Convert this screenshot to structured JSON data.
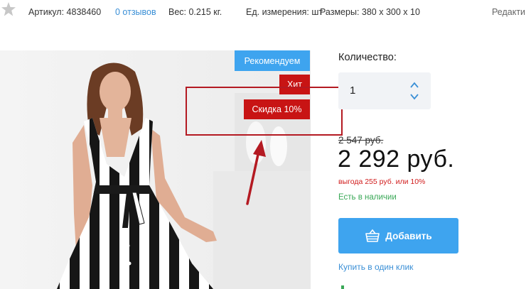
{
  "meta": {
    "article": "Артикул: 4838460",
    "reviews": "0 отзывов",
    "weight": "Вес: 0.215 кг.",
    "unit": "Ед. измерения: шт",
    "size": "Размеры: 380 x 300 x 10",
    "edit": "Редакти"
  },
  "badges": {
    "recommend": "Рекомендуем",
    "hit": "Хит",
    "discount": "Скидка 10%"
  },
  "quantity": {
    "label": "Количество:",
    "value": "1"
  },
  "price": {
    "old": "2 547 руб.",
    "current": "2 292 руб.",
    "saving": "выгода 255 руб. или 10%"
  },
  "stock": "Есть в наличии",
  "actions": {
    "add": "Добавить",
    "one_click": "Купить в один клик"
  },
  "colors": {
    "accent": "#3ea4ef",
    "badge_red": "#c81414",
    "annotation": "#b41a22",
    "in_stock": "#3aa857",
    "saving": "#d11c1c"
  },
  "icons": [
    "star-icon",
    "chevron-up-icon",
    "chevron-down-icon",
    "cart-icon"
  ]
}
